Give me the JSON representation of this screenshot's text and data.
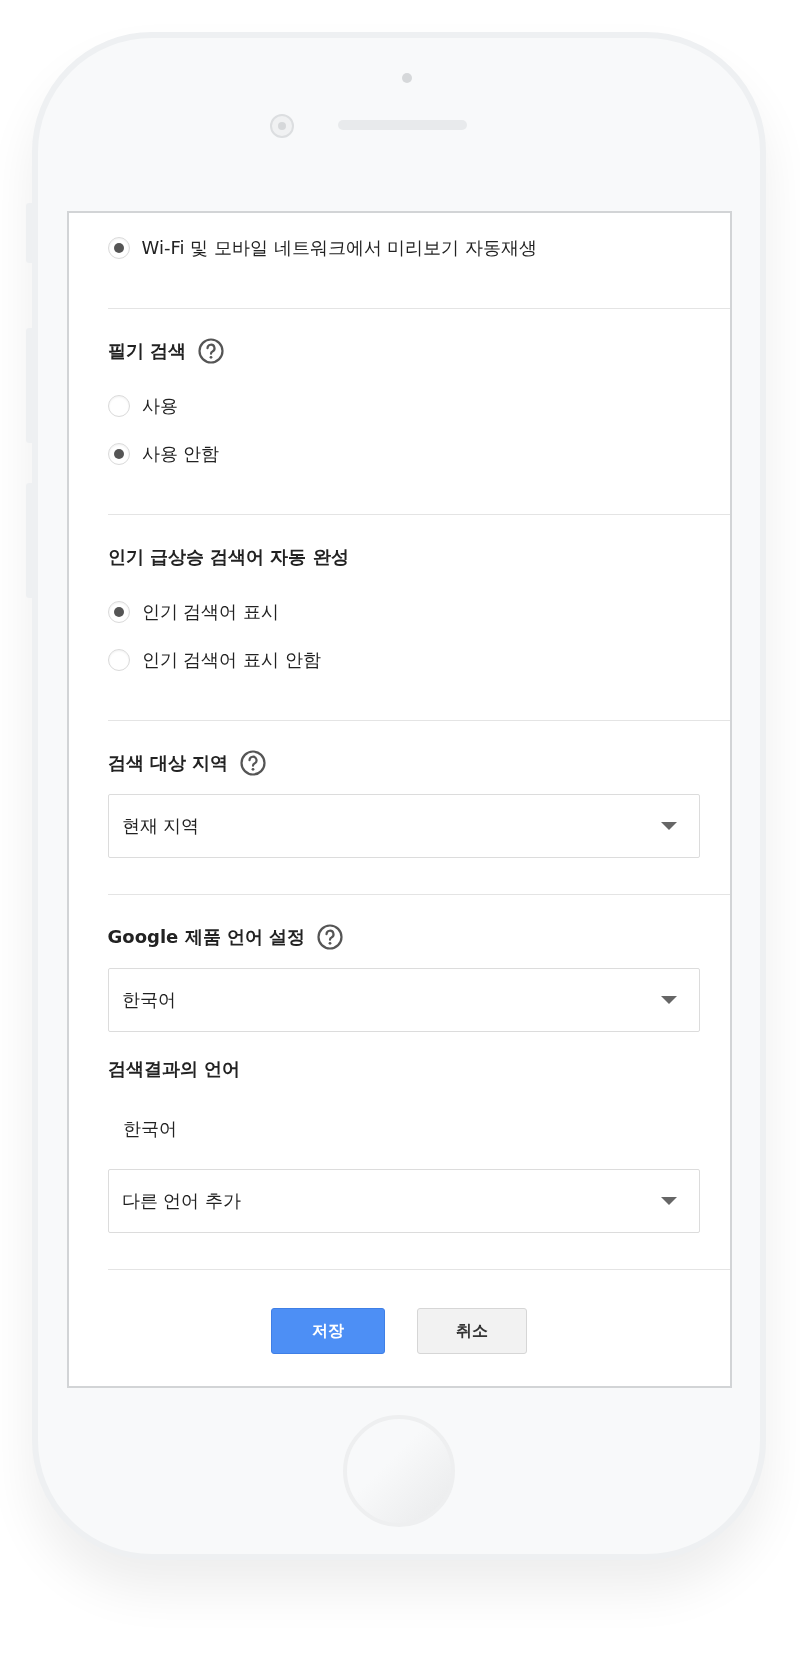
{
  "sections": [
    {
      "items": [
        {
          "kind": "radio",
          "label": "Wi-Fi 및 모바일 네트워크에서 미리보기 자동재생",
          "selected": true
        }
      ]
    },
    {
      "title": "필기 검색",
      "help": true,
      "items": [
        {
          "kind": "radio",
          "label": "사용",
          "selected": false
        },
        {
          "kind": "radio",
          "label": "사용 안함",
          "selected": true
        }
      ]
    },
    {
      "title": "인기 급상승 검색어 자동 완성",
      "help": false,
      "items": [
        {
          "kind": "radio",
          "label": "인기 검색어 표시",
          "selected": true
        },
        {
          "kind": "radio",
          "label": "인기 검색어 표시 안함",
          "selected": false
        }
      ]
    },
    {
      "title": "검색 대상 지역",
      "help": true,
      "items": [
        {
          "kind": "select",
          "value": "현재 지역"
        }
      ]
    },
    {
      "title": "Google 제품 언어 설정",
      "help": true,
      "items": [
        {
          "kind": "select",
          "value": "한국어"
        },
        {
          "kind": "subheading",
          "label": "검색결과의 언어"
        },
        {
          "kind": "text",
          "label": "한국어"
        },
        {
          "kind": "select",
          "value": "다른 언어 추가"
        }
      ]
    }
  ],
  "buttons": [
    {
      "kind": "primary",
      "label": "저장"
    },
    {
      "kind": "secondary",
      "label": "취소"
    }
  ]
}
